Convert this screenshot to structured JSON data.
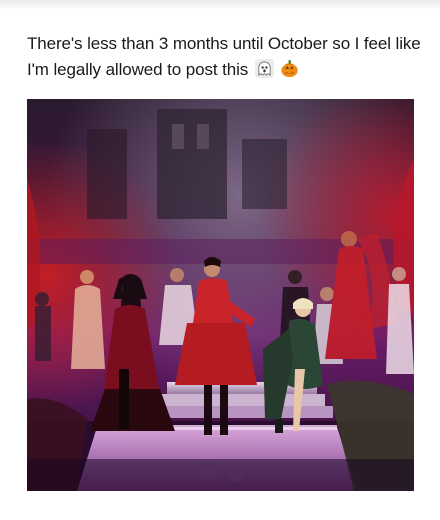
{
  "post": {
    "caption": "There's less than 3 months until October so I feel like I'm legally allowed to post this",
    "emojis": [
      "ghost-icon",
      "jack-o-lantern-icon"
    ]
  },
  "media": {
    "type": "video-still",
    "description_colors": {
      "stage_purple": "#8a2a8c",
      "stage_floor": "#c07fc4",
      "red_dress": "#c0282a",
      "green_coat": "#2f4a3a",
      "backdrop": "#2a1230"
    }
  }
}
